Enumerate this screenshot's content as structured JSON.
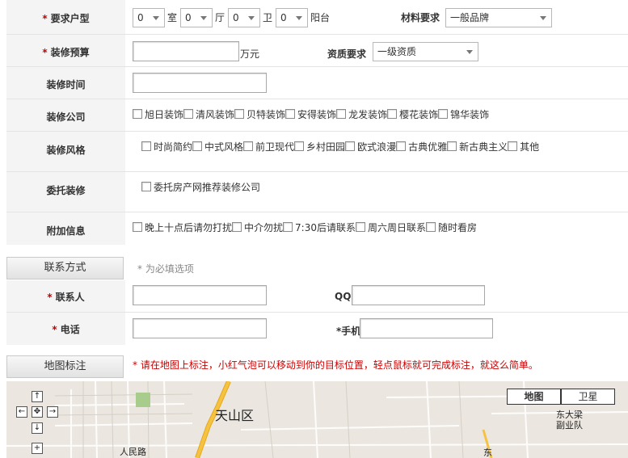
{
  "form": {
    "required_mark": "*",
    "house_type": {
      "label": "要求户型",
      "room_value": "0",
      "room_unit": "室",
      "hall_value": "0",
      "hall_unit": "厅",
      "bath_value": "0",
      "bath_unit": "卫",
      "balcony_value": "0",
      "balcony_unit": "阳台"
    },
    "material": {
      "label": "材料要求",
      "value": "一般品牌"
    },
    "budget": {
      "label": "装修预算",
      "value": "",
      "unit": "万元"
    },
    "qualification": {
      "label": "资质要求",
      "value": "一级资质"
    },
    "time": {
      "label": "装修时间",
      "value": ""
    },
    "company": {
      "label": "装修公司",
      "options": [
        "旭日装饰",
        "清风装饰",
        "贝特装饰",
        "安得装饰",
        "龙发装饰",
        "樱花装饰",
        "锦华装饰"
      ]
    },
    "style": {
      "label": "装修风格",
      "options": [
        "时尚简约",
        "中式风格",
        "前卫现代",
        "乡村田园",
        "欧式浪漫",
        "古典优雅",
        "新古典主义",
        "其他"
      ]
    },
    "entrust": {
      "label": "委托装修",
      "option": "委托房产网推荐装修公司"
    },
    "extra": {
      "label": "附加信息",
      "options": [
        "晚上十点后请勿打扰",
        "中介勿扰",
        "7:30后请联系",
        "周六周日联系",
        "随时看房"
      ]
    }
  },
  "contact_section": {
    "title": "联系方式",
    "note": "* 为必填选项",
    "person_label": "联系人",
    "qq_label": "QQ",
    "phone_label": "电话",
    "mobile_label": "*手机"
  },
  "map_section": {
    "title": "地图标注",
    "instruction": "* 请在地图上标注，小红气泡可以移动到你的目标位置，轻点鼠标就可完成标注，就这么简单。",
    "map_button": "地图",
    "satellite_button": "卫星",
    "labels": {
      "district": "天山区",
      "road": "人民路",
      "place1": "东大梁",
      "place2": "副业队",
      "place3": "东"
    },
    "controls": {
      "up": "↑",
      "down": "↓",
      "left": "←",
      "right": "→",
      "center": "✥",
      "zoom_in": "+"
    }
  },
  "colors": {
    "required": "#cc0000",
    "label_bg": "#f4f4f4",
    "road_main": "#f5c242",
    "map_bg": "#ebe7e0"
  }
}
